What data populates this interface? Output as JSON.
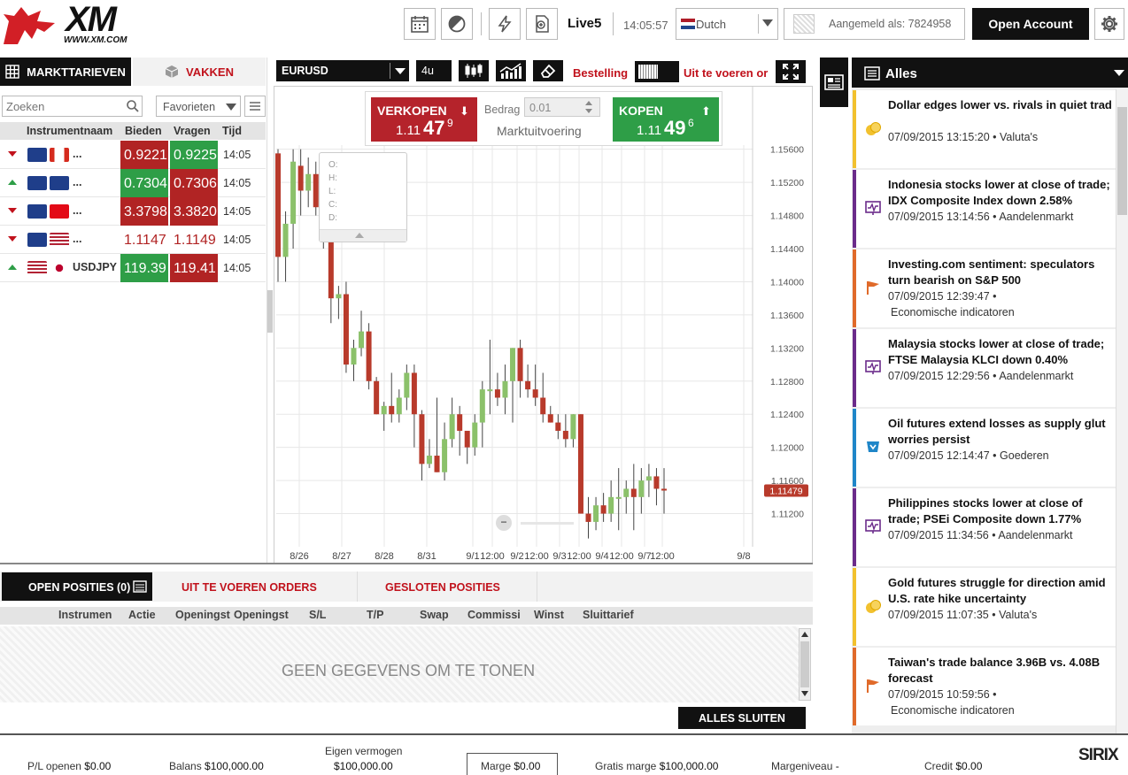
{
  "topbar": {
    "logo_text": "XM",
    "logo_url": "WWW.XM.COM",
    "account_name": "Live5",
    "time": "14:05:57",
    "language": "Dutch",
    "logged_in": "Aangemeld als: 7824958",
    "open_account": "Open Account"
  },
  "left_panel": {
    "tab_rates": "MARKTTARIEVEN",
    "tab_boxes": "VAKKEN",
    "search_placeholder": "Zoeken",
    "filter": "Favorieten",
    "col_instrument": "Instrumentnaam",
    "col_bid": "Bieden",
    "col_ask": "Vragen",
    "col_time": "Tijd",
    "rows": [
      {
        "name": "...",
        "bid": "0.9221",
        "ask": "0.9225",
        "time": "14:05"
      },
      {
        "name": "...",
        "bid": "0.7304",
        "ask": "0.7306",
        "time": "14:05"
      },
      {
        "name": "...",
        "bid": "3.3798",
        "ask": "3.3820",
        "time": "14:05"
      },
      {
        "name": "...",
        "bid": "1.1147",
        "ask": "1.1149",
        "time": "14:05"
      },
      {
        "name": "USDJPY",
        "bid": "119.39",
        "ask": "119.41",
        "time": "14:05"
      }
    ]
  },
  "chart_panel": {
    "symbol": "EURUSD",
    "timeframe": "4u",
    "order_label": "Bestelling",
    "pending_label": "Uit te voeren or",
    "sell_label": "VERKOPEN",
    "sell_price_small": "1.11",
    "sell_price_big": "47",
    "sell_price_sup": "9",
    "buy_label": "KOPEN",
    "buy_price_small": "1.11",
    "buy_price_big": "49",
    "buy_price_sup": "6",
    "amount_label": "Bedrag",
    "amount_value": "0.01",
    "execution": "Marktuitvoering",
    "ohlc": [
      "O:",
      "H:",
      "L:",
      "C:",
      "D:"
    ],
    "price_tag": "1.11479",
    "y_ticks": [
      "1.15600",
      "1.15200",
      "1.14800",
      "1.14400",
      "1.14000",
      "1.13600",
      "1.13200",
      "1.12800",
      "1.12400",
      "1.12000",
      "1.11600",
      "1.11200"
    ],
    "x_ticks": [
      "8/26",
      "8/27",
      "8/28",
      "8/31",
      "9/1",
      "12:00",
      "9/2",
      "12:00",
      "9/3",
      "12:00",
      "9/4",
      "12:00",
      "9/7",
      "12:00",
      "9/8"
    ]
  },
  "chart_data": {
    "type": "candlestick",
    "symbol": "EURUSD",
    "ylim": [
      1.108,
      1.1565
    ],
    "current_price": 1.11479,
    "candles": [
      [
        1.1555,
        1.156,
        1.14,
        1.143
      ],
      [
        1.143,
        1.1485,
        1.14,
        1.147
      ],
      [
        1.147,
        1.156,
        1.144,
        1.1545
      ],
      [
        1.154,
        1.156,
        1.148,
        1.151
      ],
      [
        1.151,
        1.155,
        1.149,
        1.153
      ],
      [
        1.153,
        1.1545,
        1.148,
        1.149
      ],
      [
        1.149,
        1.1495,
        1.144,
        1.147
      ],
      [
        1.147,
        1.148,
        1.135,
        1.138
      ],
      [
        1.138,
        1.1395,
        1.1355,
        1.1385
      ],
      [
        1.1385,
        1.14,
        1.129,
        1.13
      ],
      [
        1.13,
        1.133,
        1.128,
        1.132
      ],
      [
        1.132,
        1.1365,
        1.131,
        1.134
      ],
      [
        1.134,
        1.135,
        1.127,
        1.128
      ],
      [
        1.128,
        1.1285,
        1.124,
        1.124
      ],
      [
        1.124,
        1.1255,
        1.122,
        1.125
      ],
      [
        1.125,
        1.129,
        1.123,
        1.124
      ],
      [
        1.124,
        1.127,
        1.123,
        1.126
      ],
      [
        1.126,
        1.13,
        1.1245,
        1.129
      ],
      [
        1.129,
        1.13,
        1.12,
        1.124
      ],
      [
        1.124,
        1.1245,
        1.116,
        1.118
      ],
      [
        1.118,
        1.121,
        1.1175,
        1.119
      ],
      [
        1.119,
        1.126,
        1.117,
        1.117
      ],
      [
        1.117,
        1.123,
        1.116,
        1.121
      ],
      [
        1.121,
        1.126,
        1.12,
        1.124
      ],
      [
        1.124,
        1.125,
        1.119,
        1.122
      ],
      [
        1.122,
        1.121,
        1.118,
        1.12
      ],
      [
        1.12,
        1.124,
        1.119,
        1.123
      ],
      [
        1.123,
        1.128,
        1.12,
        1.127
      ],
      [
        1.127,
        1.133,
        1.124,
        1.127
      ],
      [
        1.127,
        1.129,
        1.125,
        1.126
      ],
      [
        1.126,
        1.13,
        1.124,
        1.128
      ],
      [
        1.128,
        1.132,
        1.123,
        1.132
      ],
      [
        1.132,
        1.133,
        1.126,
        1.128
      ],
      [
        1.128,
        1.13,
        1.126,
        1.127
      ],
      [
        1.127,
        1.13,
        1.125,
        1.126
      ],
      [
        1.126,
        1.129,
        1.123,
        1.124
      ],
      [
        1.124,
        1.125,
        1.123,
        1.123
      ],
      [
        1.123,
        1.124,
        1.121,
        1.122
      ],
      [
        1.122,
        1.124,
        1.12,
        1.121
      ],
      [
        1.121,
        1.124,
        1.12,
        1.124
      ],
      [
        1.124,
        1.124,
        1.112,
        1.112
      ],
      [
        1.112,
        1.114,
        1.109,
        1.111
      ],
      [
        1.111,
        1.114,
        1.11,
        1.113
      ],
      [
        1.113,
        1.1145,
        1.111,
        1.112
      ],
      [
        1.112,
        1.116,
        1.111,
        1.114
      ],
      [
        1.114,
        1.1175,
        1.11,
        1.114
      ],
      [
        1.114,
        1.116,
        1.112,
        1.115
      ],
      [
        1.115,
        1.118,
        1.11,
        1.114
      ],
      [
        1.114,
        1.1175,
        1.112,
        1.116
      ],
      [
        1.116,
        1.118,
        1.114,
        1.1165
      ],
      [
        1.1165,
        1.1175,
        1.113,
        1.115
      ],
      [
        1.115,
        1.1175,
        1.112,
        1.1148
      ]
    ]
  },
  "news": {
    "title": "Alles",
    "items": [
      {
        "title": "Dollar edges lower vs. rivals in quiet trad",
        "meta1": "07/09/2015 13:15:20 • Valuta's",
        "meta2": "",
        "color": "#f2c12e",
        "icon": "coins-icon"
      },
      {
        "title": "Indonesia stocks lower at close of trade; IDX Composite Index down 2.58%",
        "meta1": "07/09/2015 13:14:56 • Aandelenmarkt",
        "meta2": "",
        "color": "#6b2b8a",
        "icon": "stock-chart-icon"
      },
      {
        "title": "Investing.com sentiment: speculators turn bearish on S&P 500",
        "meta1": "07/09/2015 12:39:47 •",
        "meta2": "Economische indicatoren",
        "color": "#e06a2a",
        "icon": "flag-icon"
      },
      {
        "title": "Malaysia stocks lower at close of trade; FTSE Malaysia KLCI down 0.40%",
        "meta1": "07/09/2015 12:29:56 • Aandelenmarkt",
        "meta2": "",
        "color": "#6b2b8a",
        "icon": "stock-chart-icon"
      },
      {
        "title": "Oil futures extend losses as supply glut worries persist",
        "meta1": "07/09/2015 12:14:47 • Goederen",
        "meta2": "",
        "color": "#1f86c8",
        "icon": "cart-icon"
      },
      {
        "title": "Philippines stocks lower at close of trade; PSEi Composite down 1.77%",
        "meta1": "07/09/2015 11:34:56 • Aandelenmarkt",
        "meta2": "",
        "color": "#6b2b8a",
        "icon": "stock-chart-icon"
      },
      {
        "title": "Gold futures struggle for direction amid U.S. rate hike uncertainty",
        "meta1": "07/09/2015 11:07:35 • Valuta's",
        "meta2": "",
        "color": "#f2c12e",
        "icon": "coins-icon"
      },
      {
        "title": "Taiwan's trade balance 3.96B vs. 4.08B forecast",
        "meta1": "07/09/2015 10:59:56 •",
        "meta2": "Economische indicatoren",
        "color": "#e06a2a",
        "icon": "flag-icon"
      }
    ]
  },
  "positions": {
    "tab_open": "OPEN POSITIES (0)",
    "tab_pending": "UIT TE VOEREN ORDERS",
    "tab_closed": "GESLOTEN POSITIES",
    "columns": [
      "Instrumen",
      "Actie",
      "Openingst",
      "Openingst",
      "S/L",
      "T/P",
      "Swap",
      "Commissi",
      "Winst",
      "Sluittarief"
    ],
    "empty": "GEEN GEGEVENS OM TE TONEN",
    "close_all": "ALLES SLUITEN"
  },
  "footer": {
    "pl_label": "P/L openen",
    "pl_value": "$0.00",
    "balance_label": "Balans",
    "balance_value": "$100,000.00",
    "equity_label": "Eigen vermogen",
    "equity_value": "$100,000.00",
    "margin_label": "Marge",
    "margin_value": "$0.00",
    "free_label": "Gratis marge",
    "free_value": "$100,000.00",
    "level_label": "Margeniveau",
    "level_value": "-",
    "credit_label": "Credit",
    "credit_value": "$0.00",
    "brand": "SIRIX"
  }
}
